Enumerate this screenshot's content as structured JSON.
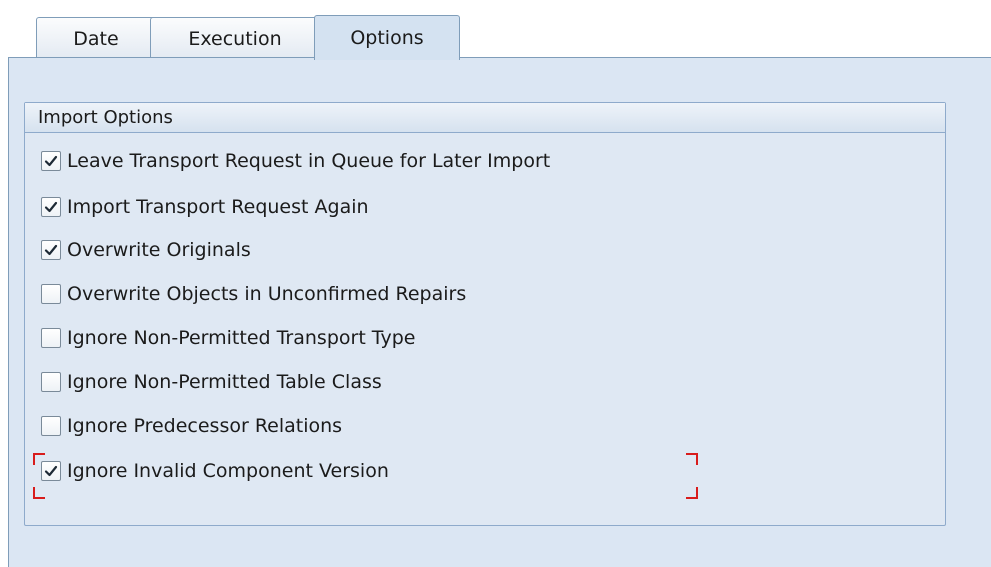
{
  "tabs": [
    {
      "label": "Date",
      "active": false
    },
    {
      "label": "Execution",
      "active": false
    },
    {
      "label": "Options",
      "active": true
    }
  ],
  "group": {
    "title": "Import Options",
    "options": [
      {
        "label": "Leave Transport Request in Queue for Later Import",
        "checked": true
      },
      {
        "label": "Import Transport Request Again",
        "checked": true
      },
      {
        "label": "Overwrite Originals",
        "checked": true
      },
      {
        "label": "Overwrite Objects in Unconfirmed Repairs",
        "checked": false
      },
      {
        "label": "Ignore Non-Permitted Transport Type",
        "checked": false
      },
      {
        "label": "Ignore Non-Permitted Table Class",
        "checked": false
      },
      {
        "label": "Ignore Predecessor Relations",
        "checked": false
      },
      {
        "label": "Ignore Invalid Component Version",
        "checked": true
      }
    ]
  },
  "colors": {
    "panel_bg": "#dbe6f3",
    "active_tab_bg": "#d4e2f1",
    "border": "#7f9db9",
    "focus_marker": "#d81c1c"
  }
}
